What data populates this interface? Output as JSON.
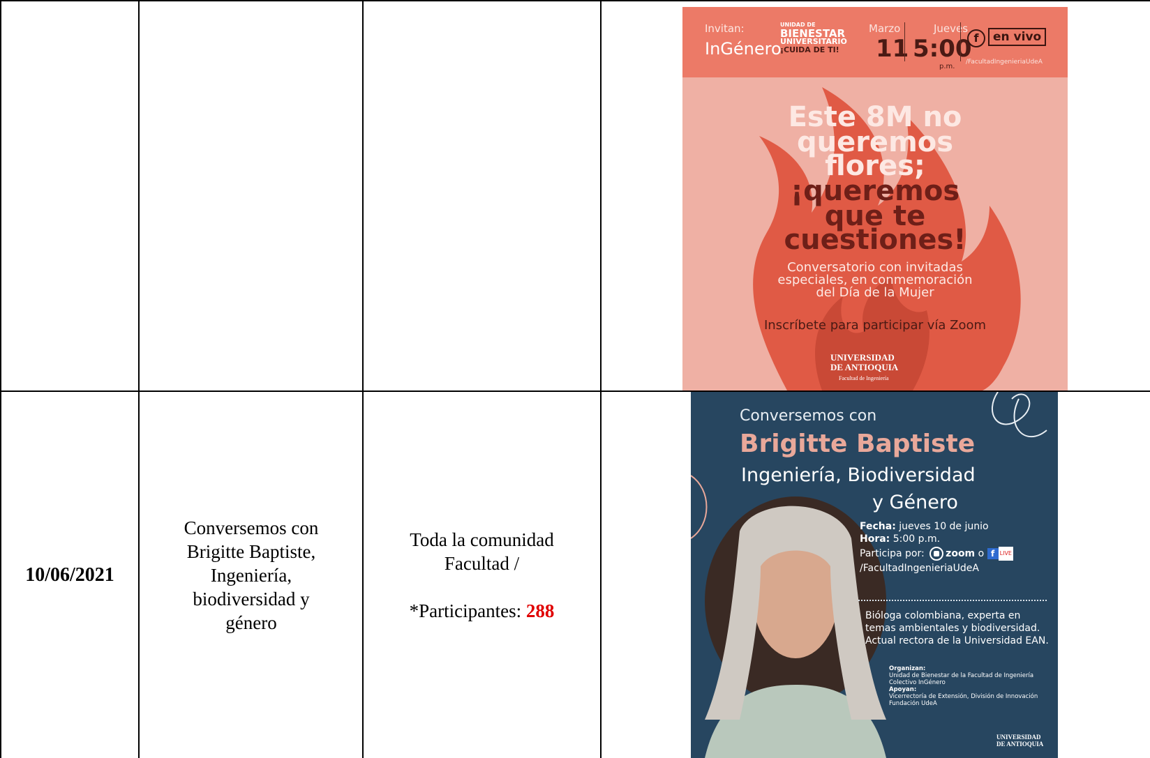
{
  "rows": [
    {
      "date": "",
      "activity": "",
      "audience": "",
      "poster": {
        "invite_label": "Invitan:",
        "org1": "InGénero",
        "org2_line1": "UNIDAD DE",
        "org2_line2": "BIENESTAR",
        "org2_line3": "UNIVERSITARIO",
        "org2_line4": "¡CUIDA DE TI!",
        "month": "Marzo",
        "day": "11",
        "weekday": "Jueves",
        "time": "5:00",
        "time_suffix": "p.m.",
        "live_label": "en vivo",
        "fb_handle": "/FacultadIngenieriaUdeA",
        "headline_1": "Este 8M no",
        "headline_2": "queremos",
        "headline_3": "flores;",
        "headline_4": "¡queremos",
        "headline_5": "que te",
        "headline_6": "cuestiones!",
        "sub_1": "Conversatorio con invitadas",
        "sub_2": "especiales, en conmemoración",
        "sub_3": "del Día de la Mujer",
        "register": "Inscríbete para participar vía Zoom",
        "univ_1": "UNIVERSIDAD",
        "univ_2": "DE ANTIOQUIA",
        "faculty": "Facultad de Ingeniería"
      }
    },
    {
      "date": "10/06/2021",
      "activity": "Conversemos con Brigitte Baptiste, Ingeniería, biodiversidad y género",
      "audience_line1": "Toda la comunidad",
      "audience_line2": "Facultad /",
      "participants_label": "*Participantes: ",
      "participants_value": "288",
      "poster": {
        "conversemos": "Conversemos con",
        "name": "Brigitte Baptiste",
        "subject_1": "Ingeniería, Biodiversidad",
        "subject_2": "y Género",
        "fecha_label": "Fecha:",
        "fecha_value": " jueves 10 de junio",
        "hora_label": "Hora:",
        "hora_value": " 5:00 p.m.",
        "participa": "Participa por:",
        "zoom": "zoom",
        "or": "o",
        "live": "LIVE",
        "handle": "/FacultadIngenieriaUdeA",
        "bio": "Bióloga colombiana, experta en temas ambientales y biodiversidad. Actual rectora de la Universidad EAN.",
        "organizan_label": "Organizan:",
        "organizan_1": "Unidad de Bienestar de la Facultad de Ingeniería",
        "organizan_2": "Colectivo InGénero",
        "apoyan_label": "Apoyan:",
        "apoyan_1": "Vicerrectoría de Extensión, División de Innovación",
        "apoyan_2": "Fundación UdeA",
        "univ_1": "UNIVERSIDAD",
        "univ_2": "DE ANTIOQUIA"
      }
    }
  ]
}
